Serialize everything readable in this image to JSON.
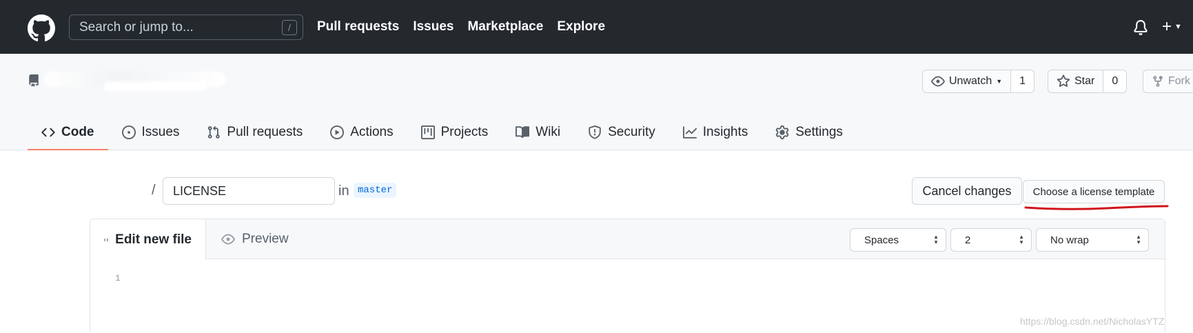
{
  "header": {
    "search_placeholder": "Search or jump to...",
    "search_shortcut": "/",
    "nav": [
      "Pull requests",
      "Issues",
      "Marketplace",
      "Explore"
    ],
    "plus_label": "+"
  },
  "repo": {
    "watch_label": "Unwatch",
    "watch_count": "1",
    "star_label": "Star",
    "star_count": "0",
    "fork_label": "Fork"
  },
  "tabs": [
    {
      "label": "Code",
      "icon": "code-icon",
      "active": true
    },
    {
      "label": "Issues",
      "icon": "issue-icon"
    },
    {
      "label": "Pull requests",
      "icon": "pull-request-icon"
    },
    {
      "label": "Actions",
      "icon": "play-icon"
    },
    {
      "label": "Projects",
      "icon": "project-icon"
    },
    {
      "label": "Wiki",
      "icon": "book-icon"
    },
    {
      "label": "Security",
      "icon": "shield-icon"
    },
    {
      "label": "Insights",
      "icon": "graph-icon"
    },
    {
      "label": "Settings",
      "icon": "gear-icon"
    }
  ],
  "file": {
    "separator": "/",
    "filename": "LICENSE",
    "in_label": "in",
    "branch": "master"
  },
  "buttons": {
    "cancel": "Cancel changes",
    "license_template": "Choose a license template"
  },
  "editor": {
    "edit_tab": "Edit new file",
    "preview_tab": "Preview",
    "indent_mode": "Spaces",
    "indent_size": "2",
    "wrap_mode": "No wrap",
    "line_numbers": [
      "1"
    ]
  },
  "watermark": "https://blog.csdn.net/NicholasYTZ",
  "colors": {
    "header_bg": "#24292e",
    "active_tab_underline": "#f9826c",
    "annotation_red": "#d0141c",
    "branch_bg": "#eaf5ff",
    "branch_text": "#0366d6"
  }
}
